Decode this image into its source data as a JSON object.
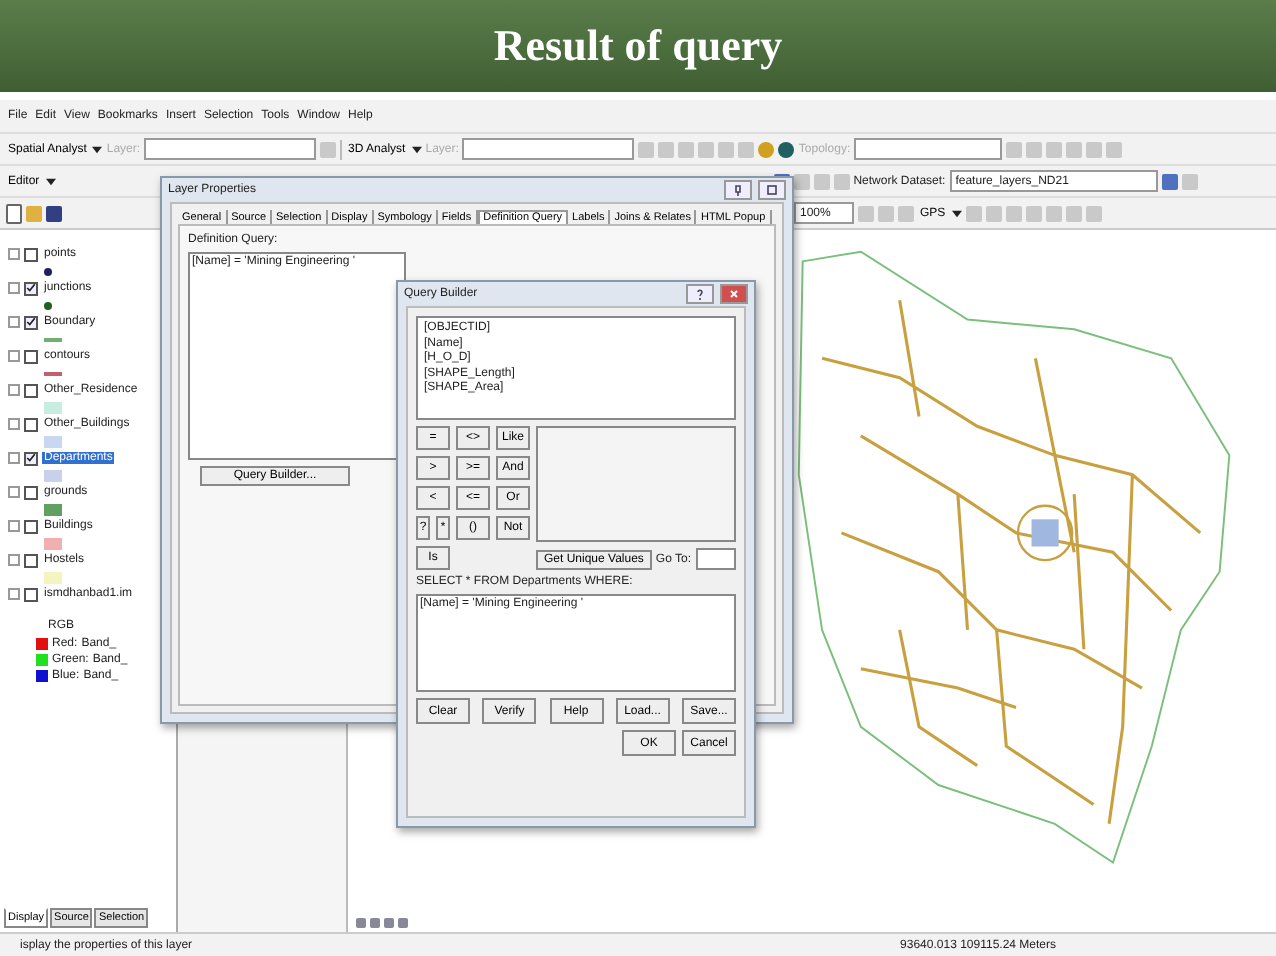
{
  "slide_title": "Result of query",
  "menu": [
    "File",
    "Edit",
    "View",
    "Bookmarks",
    "Insert",
    "Selection",
    "Tools",
    "Window",
    "Help"
  ],
  "toolbar_1": {
    "spatial_analyst": "Spatial Analyst",
    "layer_label_1": "Layer:",
    "analyst_3d": "3D Analyst",
    "layer_label_2": "Layer:",
    "topology_label": "Topology:"
  },
  "toolbar_2": {
    "editor": "Editor",
    "network_label": "Network Dataset:",
    "network_value": "feature_layers_ND21"
  },
  "toolbar_3": {
    "zoom_value": "100%",
    "gps": "GPS"
  },
  "toc": {
    "layers": [
      {
        "name": "points",
        "checked": false,
        "selected": false,
        "symbol": {
          "kind": "dot",
          "color": "#202060"
        }
      },
      {
        "name": "junctions",
        "checked": true,
        "selected": false,
        "symbol": {
          "kind": "dot",
          "color": "#206020"
        }
      },
      {
        "name": "Boundary",
        "checked": true,
        "selected": false,
        "symbol": {
          "kind": "line",
          "color": "#70b070"
        }
      },
      {
        "name": "contours",
        "checked": false,
        "selected": false,
        "symbol": {
          "kind": "line",
          "color": "#c06070"
        }
      },
      {
        "name": "Other_Residence",
        "checked": false,
        "selected": false,
        "symbol": {
          "kind": "patch",
          "color": "#c8ece0"
        }
      },
      {
        "name": "Other_Buildings",
        "checked": false,
        "selected": false,
        "symbol": {
          "kind": "patch",
          "color": "#c8d8f0"
        }
      },
      {
        "name": "Departments",
        "checked": true,
        "selected": true,
        "symbol": {
          "kind": "patch",
          "color": "#c8d0ec"
        }
      },
      {
        "name": "grounds",
        "checked": false,
        "selected": false,
        "symbol": {
          "kind": "patch",
          "color": "#60a060"
        }
      },
      {
        "name": "Buildings",
        "checked": false,
        "selected": false,
        "symbol": {
          "kind": "patch",
          "color": "#f0b0b0"
        }
      },
      {
        "name": "Hostels",
        "checked": false,
        "selected": false,
        "symbol": {
          "kind": "patch",
          "color": "#f4f4c0"
        }
      },
      {
        "name": "ismdhanbad1.im",
        "checked": false,
        "selected": false,
        "symbol": {
          "kind": "raster"
        },
        "legend_title": "RGB",
        "bands": [
          {
            "label": "Red:",
            "value": "Band_",
            "color": "#e01010"
          },
          {
            "label": "Green:",
            "value": "Band_",
            "color": "#20e020"
          },
          {
            "label": "Blue:",
            "value": "Band_",
            "color": "#1010d0"
          }
        ]
      }
    ],
    "tabs": [
      {
        "label": "Display",
        "selected": true
      },
      {
        "label": "Source",
        "selected": false
      },
      {
        "label": "Selection",
        "selected": false
      }
    ]
  },
  "layer_properties": {
    "title": "Layer Properties",
    "tabs": [
      {
        "label": "General",
        "selected": false
      },
      {
        "label": "Source",
        "selected": false
      },
      {
        "label": "Selection",
        "selected": false
      },
      {
        "label": "Display",
        "selected": false
      },
      {
        "label": "Symbology",
        "selected": false
      },
      {
        "label": "Fields",
        "selected": false
      },
      {
        "label": "Definition Query",
        "selected": true
      },
      {
        "label": "Labels",
        "selected": false
      },
      {
        "label": "Joins & Relates",
        "selected": false
      },
      {
        "label": "HTML Popup",
        "selected": false
      }
    ],
    "definition_label": "Definition Query:",
    "definition_value": "[Name] = 'Mining Engineering '",
    "query_builder_button": "Query Builder..."
  },
  "query_builder": {
    "title": "Query Builder",
    "fields": [
      "[OBJECTID]",
      "[Name]",
      "[H_O_D]",
      "[SHAPE_Length]",
      "[SHAPE_Area]"
    ],
    "operators": [
      [
        "=",
        "<>",
        "Like"
      ],
      [
        ">",
        ">=",
        "And"
      ],
      [
        "<",
        "<=",
        "Or"
      ],
      [
        "?",
        "*",
        "()",
        "Not"
      ],
      [
        "Is"
      ]
    ],
    "unique_values_button": "Get Unique Values",
    "goto_label": "Go To:",
    "select_label": "SELECT * FROM Departments WHERE:",
    "expression": "[Name] = 'Mining Engineering '",
    "buttons": [
      "Clear",
      "Verify",
      "Help",
      "Load...",
      "Save..."
    ],
    "ok": "OK",
    "cancel": "Cancel"
  },
  "status_bar": {
    "message": "isplay the properties of this layer",
    "coordinates": "93640.013  109115.24 Meters"
  }
}
